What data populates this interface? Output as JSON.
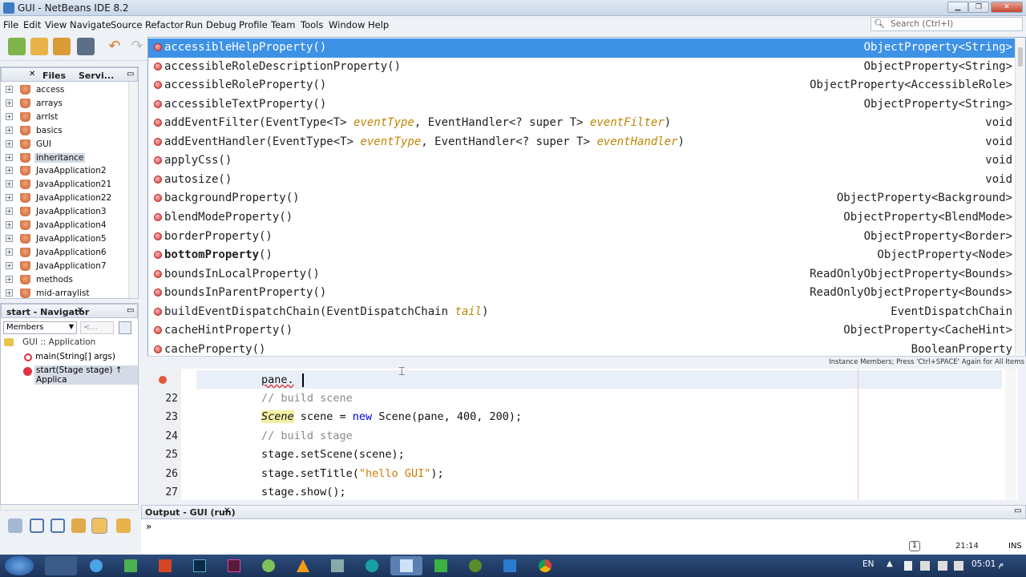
{
  "window": {
    "title": "GUI - NetBeans IDE 8.2",
    "search_placeholder": "Search (Ctrl+I)"
  },
  "menu": [
    "File",
    "Edit",
    "View",
    "Navigate",
    "Source",
    "Refactor",
    "Run",
    "Debug",
    "Profile",
    "Team",
    "Tools",
    "Window",
    "Help"
  ],
  "projects_panel": {
    "tabs": [
      "Files",
      "Servi..."
    ],
    "items": [
      "access",
      "arrays",
      "arrlst",
      "basics",
      "GUI",
      "inheritance",
      "JavaApplication2",
      "JavaApplication21",
      "JavaApplication22",
      "JavaApplication3",
      "JavaApplication4",
      "JavaApplication5",
      "JavaApplication6",
      "JavaApplication7",
      "methods",
      "mid-arraylist"
    ],
    "selected": "inheritance"
  },
  "navigator": {
    "title": "start - Navigator",
    "filter": "Members",
    "filter2": "<...",
    "root": "GUI :: Application",
    "members": [
      "main(String[] args)",
      "start(Stage stage) ↑ Applica"
    ]
  },
  "completion": {
    "items": [
      {
        "name": "accessibleHelpProperty()",
        "type": "ObjectProperty<String>",
        "selected": true
      },
      {
        "name": "accessibleRoleDescriptionProperty()",
        "type": "ObjectProperty<String>"
      },
      {
        "name": "accessibleRoleProperty()",
        "type": "ObjectProperty<AccessibleRole>"
      },
      {
        "name": "accessibleTextProperty()",
        "type": "ObjectProperty<String>"
      },
      {
        "name_pre": "addEventFilter(EventType<T> ",
        "p1": "eventType",
        "name_mid": ", EventHandler<? super T> ",
        "p2": "eventFilter",
        "name_post": ")",
        "type": "void"
      },
      {
        "name_pre": "addEventHandler(EventType<T> ",
        "p1": "eventType",
        "name_mid": ", EventHandler<? super T> ",
        "p2": "eventHandler",
        "name_post": ")",
        "type": "void"
      },
      {
        "name": "applyCss()",
        "type": "void"
      },
      {
        "name": "autosize()",
        "type": "void"
      },
      {
        "name": "backgroundProperty()",
        "type": "ObjectProperty<Background>"
      },
      {
        "name": "blendModeProperty()",
        "type": "ObjectProperty<BlendMode>"
      },
      {
        "name": "borderProperty()",
        "type": "ObjectProperty<Border>"
      },
      {
        "name_bold": "bottomProperty",
        "name_post": "()",
        "type": "ObjectProperty<Node>"
      },
      {
        "name": "boundsInLocalProperty()",
        "type": "ReadOnlyObjectProperty<Bounds>"
      },
      {
        "name": "boundsInParentProperty()",
        "type": "ReadOnlyObjectProperty<Bounds>"
      },
      {
        "name_pre": "buildEventDispatchChain(EventDispatchChain ",
        "p1": "tail",
        "name_post": ")",
        "type": "EventDispatchChain"
      },
      {
        "name": "cacheHintProperty()",
        "type": "ObjectProperty<CacheHint>"
      },
      {
        "name": "cacheProperty()",
        "type": "BooleanProperty"
      }
    ],
    "footer": "Instance Members; Press 'Ctrl+SPACE' Again for All Items"
  },
  "editor": {
    "current_line": "pane.",
    "lines": [
      {
        "n": "22",
        "text": "// build scene"
      },
      {
        "n": "23",
        "cls": "Scene",
        "mid": " scene = ",
        "kw": "new",
        "post": " Scene(pane, 400, 200);"
      },
      {
        "n": "24",
        "text": "// build stage"
      },
      {
        "n": "25",
        "text": "stage.setScene(scene);"
      },
      {
        "n": "26",
        "pre": "stage.setTitle(",
        "str": "\"hello GUI\"",
        "post": ");"
      },
      {
        "n": "27",
        "text": "stage.show();"
      }
    ]
  },
  "output": {
    "tab": "Output - GUI (run)",
    "prompt": "»"
  },
  "status": {
    "position": "21:14",
    "mode": "INS",
    "notifications": "1"
  },
  "taskbar": {
    "lang": "EN",
    "time": "05:01 م"
  }
}
